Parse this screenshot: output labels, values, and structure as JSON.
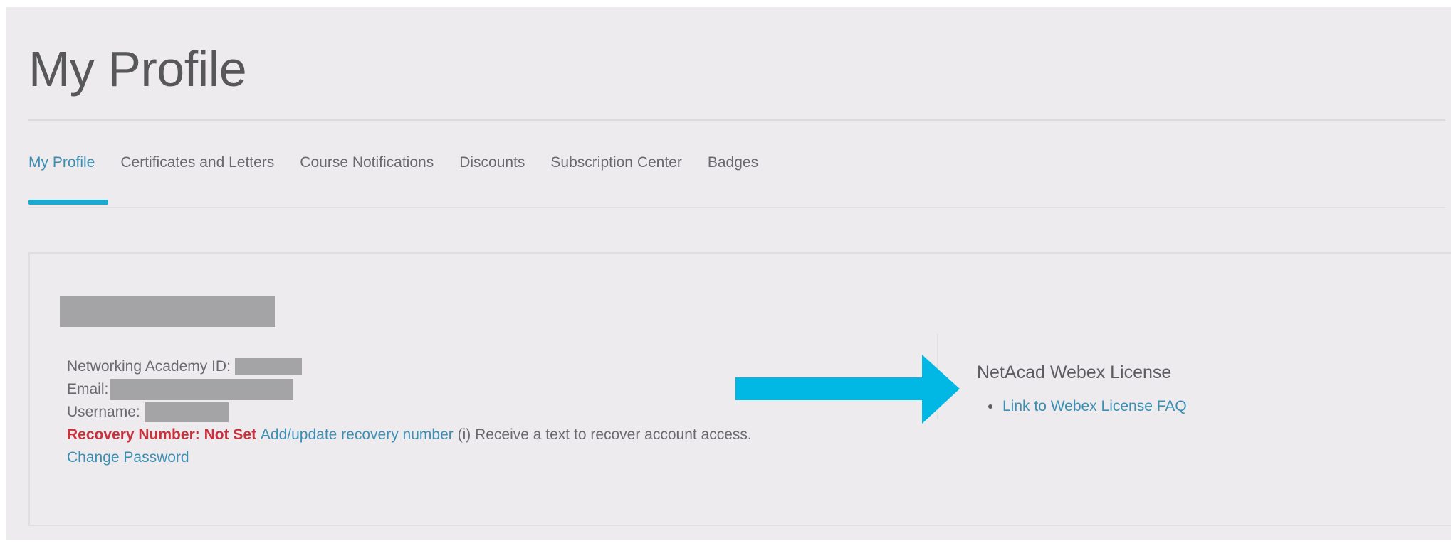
{
  "page": {
    "title": "My Profile"
  },
  "tabs": [
    {
      "label": "My Profile",
      "active": true
    },
    {
      "label": "Certificates and Letters",
      "active": false
    },
    {
      "label": "Course Notifications",
      "active": false
    },
    {
      "label": "Discounts",
      "active": false
    },
    {
      "label": "Subscription Center",
      "active": false
    },
    {
      "label": "Badges",
      "active": false
    }
  ],
  "profile": {
    "netacad_id_label": "Networking Academy ID:",
    "email_label": "Email:",
    "username_label": "Username:",
    "recovery_label": "Recovery Number: Not Set",
    "recovery_link": "Add/update recovery number",
    "recovery_help": "(i) Receive a text to recover account access.",
    "change_password": "Change Password"
  },
  "webex": {
    "title": "NetAcad Webex License",
    "faq_link": "Link to Webex License FAQ"
  },
  "colors": {
    "accent": "#1ba9d1",
    "link": "#3b8fb3",
    "warning": "#c8323c",
    "arrow": "#00b8e3",
    "background": "#edebee",
    "redaction": "#a4a3a5"
  },
  "icons": {
    "annotation": "right-arrow-icon"
  }
}
